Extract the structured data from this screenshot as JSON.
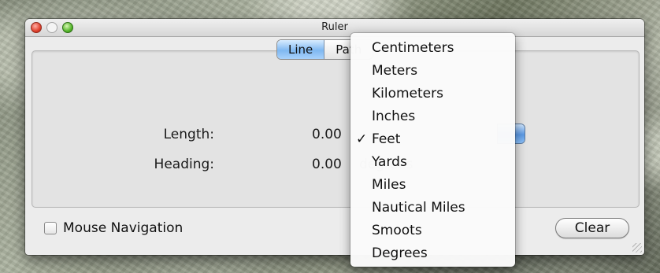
{
  "window": {
    "title": "Ruler"
  },
  "tabs": [
    {
      "label": "Line",
      "active": true
    },
    {
      "label": "Path",
      "active": false
    }
  ],
  "measurements": {
    "length_label": "Length:",
    "length_value": "0.00",
    "heading_label": "Heading:",
    "heading_value": "0.00",
    "heading_unit": "degrees"
  },
  "mouse_navigation": {
    "label": "Mouse Navigation",
    "checked": false
  },
  "clear_button": {
    "label": "Clear"
  },
  "unit_menu": {
    "selected": "Feet",
    "check_glyph": "✓",
    "items": [
      "Centimeters",
      "Meters",
      "Kilometers",
      "Inches",
      "Feet",
      "Yards",
      "Miles",
      "Nautical Miles",
      "Smoots",
      "Degrees"
    ]
  },
  "colors": {
    "accent": "#5b9ae6",
    "window_bg": "#ececec"
  }
}
